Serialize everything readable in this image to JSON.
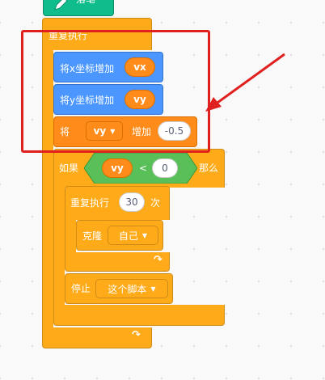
{
  "pen_block": {
    "label": "落笔",
    "icon": "pencil-icon"
  },
  "outer_loop": {
    "label": "重复执行",
    "loop_icon": "loop-arrow-icon"
  },
  "change_x": {
    "label": "将x坐标增加",
    "value": "vx"
  },
  "change_y": {
    "label": "将y坐标增加",
    "value": "vy"
  },
  "change_var": {
    "prefix": "将",
    "variable": "vy",
    "middle": "增加",
    "value": "-0.5"
  },
  "if_block": {
    "prefix": "如果",
    "left": "vy",
    "operator": "<",
    "right": "0",
    "suffix": "那么"
  },
  "repeat_block": {
    "label": "重复执行",
    "count": "30",
    "suffix": "次",
    "loop_icon": "loop-arrow-icon"
  },
  "clone_block": {
    "label": "克隆",
    "target": "自己"
  },
  "stop_block": {
    "label": "停止",
    "option": "这个脚本"
  },
  "annotation": {
    "highlight_color": "#e0201f",
    "arrow_color": "#e0201f"
  },
  "colors": {
    "control": "#ffab19",
    "motion": "#4c97ff",
    "variables": "#ff8c1a",
    "operators": "#59c059",
    "pen": "#0fbd8c"
  }
}
